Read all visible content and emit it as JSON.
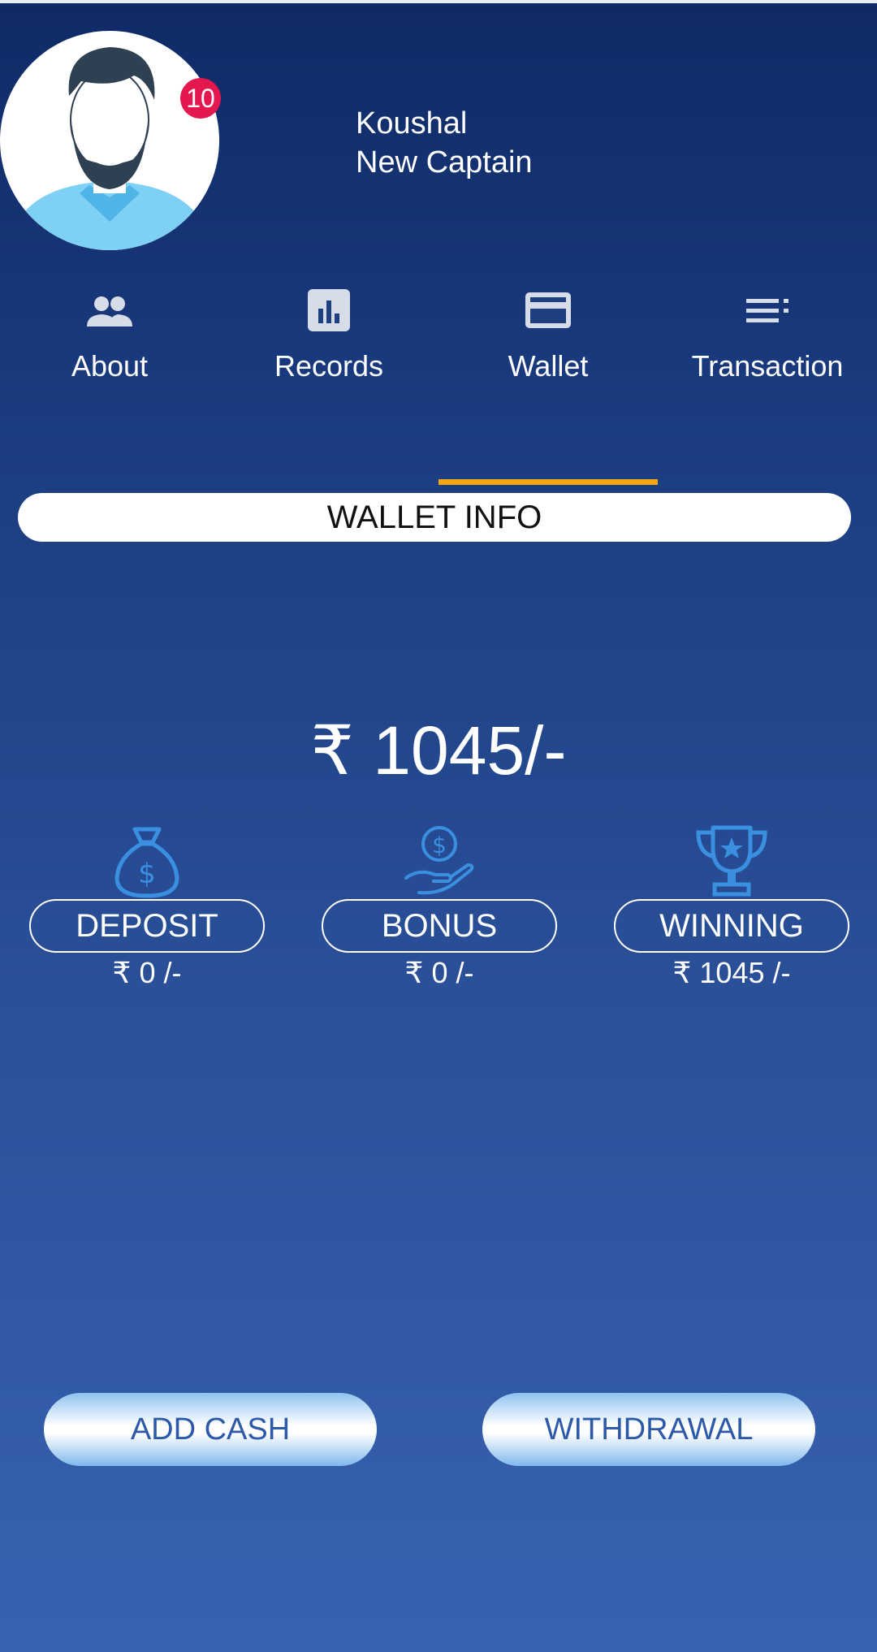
{
  "profile": {
    "name": "Koushal",
    "rank": "New Captain",
    "notification_count": "10"
  },
  "tabs": [
    {
      "label": "About",
      "icon": "people-icon"
    },
    {
      "label": "Records",
      "icon": "bar-chart-icon"
    },
    {
      "label": "Wallet",
      "icon": "credit-card-icon"
    },
    {
      "label": "Transaction",
      "icon": "list-icon"
    }
  ],
  "active_tab": "Wallet",
  "wallet": {
    "header": "WALLET INFO",
    "total": "₹ 1045/-",
    "stats": [
      {
        "label": "DEPOSIT",
        "value": "₹ 0 /-",
        "icon": "money-bag-icon"
      },
      {
        "label": "BONUS",
        "value": "₹ 0 /-",
        "icon": "coin-hand-icon"
      },
      {
        "label": "WINNING",
        "value": "₹ 1045 /-",
        "icon": "trophy-icon"
      }
    ]
  },
  "actions": {
    "add_cash": "ADD CASH",
    "withdrawal": "WITHDRAWAL"
  },
  "colors": {
    "accent": "#f3a712",
    "badge": "#e5174f",
    "icon_blue": "#3a8fe0",
    "button_text": "#2d5aa8"
  }
}
